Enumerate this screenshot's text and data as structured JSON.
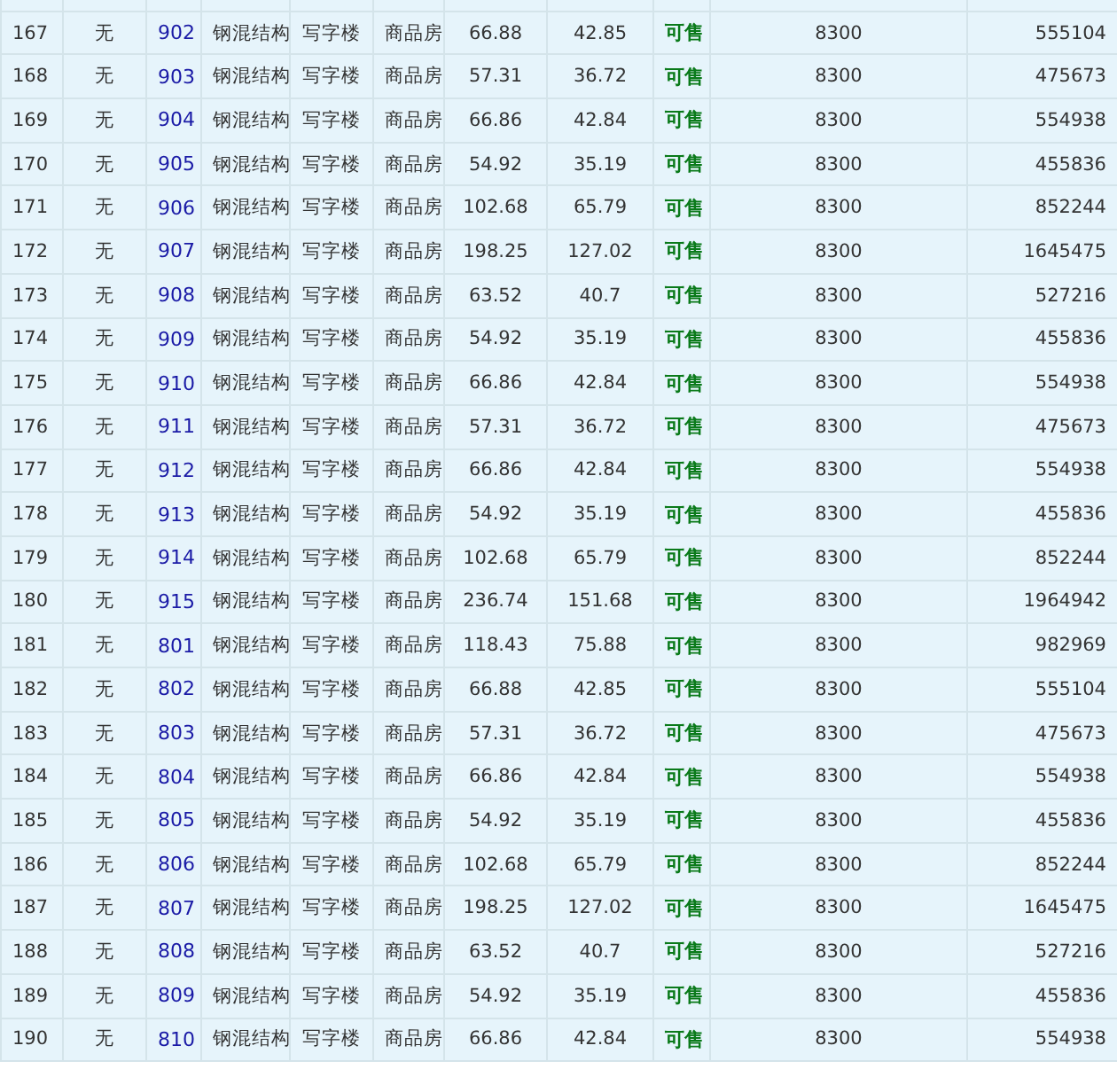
{
  "table": {
    "rows": [
      {
        "cells": [
          "167",
          "无",
          "902",
          "钢混结构",
          "写字楼",
          "商品房",
          "66.88",
          "42.85",
          "可售",
          "8300",
          "555104"
        ]
      },
      {
        "cells": [
          "168",
          "无",
          "903",
          "钢混结构",
          "写字楼",
          "商品房",
          "57.31",
          "36.72",
          "可售",
          "8300",
          "475673"
        ]
      },
      {
        "cells": [
          "169",
          "无",
          "904",
          "钢混结构",
          "写字楼",
          "商品房",
          "66.86",
          "42.84",
          "可售",
          "8300",
          "554938"
        ]
      },
      {
        "cells": [
          "170",
          "无",
          "905",
          "钢混结构",
          "写字楼",
          "商品房",
          "54.92",
          "35.19",
          "可售",
          "8300",
          "455836"
        ]
      },
      {
        "cells": [
          "171",
          "无",
          "906",
          "钢混结构",
          "写字楼",
          "商品房",
          "102.68",
          "65.79",
          "可售",
          "8300",
          "852244"
        ]
      },
      {
        "cells": [
          "172",
          "无",
          "907",
          "钢混结构",
          "写字楼",
          "商品房",
          "198.25",
          "127.02",
          "可售",
          "8300",
          "1645475"
        ]
      },
      {
        "cells": [
          "173",
          "无",
          "908",
          "钢混结构",
          "写字楼",
          "商品房",
          "63.52",
          "40.7",
          "可售",
          "8300",
          "527216"
        ]
      },
      {
        "cells": [
          "174",
          "无",
          "909",
          "钢混结构",
          "写字楼",
          "商品房",
          "54.92",
          "35.19",
          "可售",
          "8300",
          "455836"
        ]
      },
      {
        "cells": [
          "175",
          "无",
          "910",
          "钢混结构",
          "写字楼",
          "商品房",
          "66.86",
          "42.84",
          "可售",
          "8300",
          "554938"
        ]
      },
      {
        "cells": [
          "176",
          "无",
          "911",
          "钢混结构",
          "写字楼",
          "商品房",
          "57.31",
          "36.72",
          "可售",
          "8300",
          "475673"
        ]
      },
      {
        "cells": [
          "177",
          "无",
          "912",
          "钢混结构",
          "写字楼",
          "商品房",
          "66.86",
          "42.84",
          "可售",
          "8300",
          "554938"
        ]
      },
      {
        "cells": [
          "178",
          "无",
          "913",
          "钢混结构",
          "写字楼",
          "商品房",
          "54.92",
          "35.19",
          "可售",
          "8300",
          "455836"
        ]
      },
      {
        "cells": [
          "179",
          "无",
          "914",
          "钢混结构",
          "写字楼",
          "商品房",
          "102.68",
          "65.79",
          "可售",
          "8300",
          "852244"
        ]
      },
      {
        "cells": [
          "180",
          "无",
          "915",
          "钢混结构",
          "写字楼",
          "商品房",
          "236.74",
          "151.68",
          "可售",
          "8300",
          "1964942"
        ]
      },
      {
        "cells": [
          "181",
          "无",
          "801",
          "钢混结构",
          "写字楼",
          "商品房",
          "118.43",
          "75.88",
          "可售",
          "8300",
          "982969"
        ]
      },
      {
        "cells": [
          "182",
          "无",
          "802",
          "钢混结构",
          "写字楼",
          "商品房",
          "66.88",
          "42.85",
          "可售",
          "8300",
          "555104"
        ]
      },
      {
        "cells": [
          "183",
          "无",
          "803",
          "钢混结构",
          "写字楼",
          "商品房",
          "57.31",
          "36.72",
          "可售",
          "8300",
          "475673"
        ]
      },
      {
        "cells": [
          "184",
          "无",
          "804",
          "钢混结构",
          "写字楼",
          "商品房",
          "66.86",
          "42.84",
          "可售",
          "8300",
          "554938"
        ]
      },
      {
        "cells": [
          "185",
          "无",
          "805",
          "钢混结构",
          "写字楼",
          "商品房",
          "54.92",
          "35.19",
          "可售",
          "8300",
          "455836"
        ]
      },
      {
        "cells": [
          "186",
          "无",
          "806",
          "钢混结构",
          "写字楼",
          "商品房",
          "102.68",
          "65.79",
          "可售",
          "8300",
          "852244"
        ]
      },
      {
        "cells": [
          "187",
          "无",
          "807",
          "钢混结构",
          "写字楼",
          "商品房",
          "198.25",
          "127.02",
          "可售",
          "8300",
          "1645475"
        ]
      },
      {
        "cells": [
          "188",
          "无",
          "808",
          "钢混结构",
          "写字楼",
          "商品房",
          "63.52",
          "40.7",
          "可售",
          "8300",
          "527216"
        ]
      },
      {
        "cells": [
          "189",
          "无",
          "809",
          "钢混结构",
          "写字楼",
          "商品房",
          "54.92",
          "35.19",
          "可售",
          "8300",
          "455836"
        ]
      },
      {
        "cells": [
          "190",
          "无",
          "810",
          "钢混结构",
          "写字楼",
          "商品房",
          "66.86",
          "42.84",
          "可售",
          "8300",
          "554938"
        ]
      }
    ]
  }
}
